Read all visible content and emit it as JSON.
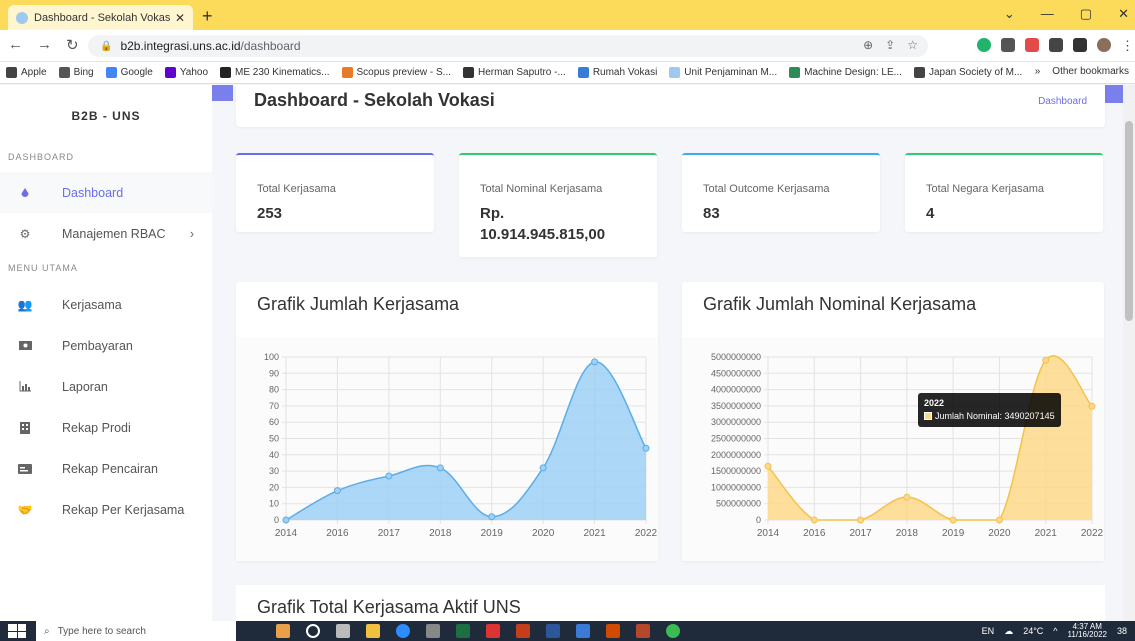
{
  "browser": {
    "tab_title": "Dashboard - Sekolah Vokasi — [",
    "url_host": "b2b.integrasi.uns.ac.id",
    "url_path": "/dashboard",
    "bookmarks": [
      "Apple",
      "Bing",
      "Google",
      "Yahoo",
      "ME 230 Kinematics...",
      "Scopus preview - S...",
      "Herman Saputro -...",
      "Rumah Vokasi",
      "Unit Penjaminan M...",
      "Machine Design: LE...",
      "Japan Society of M..."
    ],
    "other_bookmarks": "Other bookmarks"
  },
  "sidebar": {
    "brand": "B2B - UNS",
    "section_dashboard": "DASHBOARD",
    "section_menu": "MENU UTAMA",
    "items": [
      {
        "label": "Dashboard",
        "icon": "droplet-icon"
      },
      {
        "label": "Manajemen RBAC",
        "icon": "gears-icon"
      },
      {
        "label": "Kerjasama",
        "icon": "users-icon"
      },
      {
        "label": "Pembayaran",
        "icon": "money-icon"
      },
      {
        "label": "Laporan",
        "icon": "chart-icon"
      },
      {
        "label": "Rekap Prodi",
        "icon": "building-icon"
      },
      {
        "label": "Rekap Pencairan",
        "icon": "card-icon"
      },
      {
        "label": "Rekap Per Kerjasama",
        "icon": "handshake-icon"
      }
    ]
  },
  "header": {
    "title": "Dashboard - Sekolah Vokasi",
    "breadcrumb": "Dashboard"
  },
  "stats": [
    {
      "label": "Total Kerjasama",
      "value": "253",
      "color": "#6a6ee8"
    },
    {
      "label": "Total Nominal Kerjasama",
      "value": "Rp. 10.914.945.815,00",
      "color": "#2ecc71"
    },
    {
      "label": "Total Outcome Kerjasama",
      "value": "83",
      "color": "#3fa9f5"
    },
    {
      "label": "Total Negara Kerjasama",
      "value": "4",
      "color": "#2ecc71"
    }
  ],
  "charts": {
    "left_title": "Grafik Jumlah Kerjasama",
    "right_title": "Grafik Jumlah Nominal Kerjasama",
    "bottom_title": "Grafik Total Kerjasama Aktif UNS",
    "tooltip_year": "2022",
    "tooltip_label": "Jumlah Nominal: 3490207145"
  },
  "chart_data": [
    {
      "type": "area",
      "title": "Grafik Jumlah Kerjasama",
      "x": [
        "2014",
        "2016",
        "2017",
        "2018",
        "2019",
        "2020",
        "2021",
        "2022"
      ],
      "values": [
        0,
        18,
        27,
        32,
        2,
        32,
        97,
        44
      ],
      "ylim": [
        0,
        100
      ],
      "yticks": [
        0,
        10,
        20,
        30,
        40,
        50,
        60,
        70,
        80,
        90,
        100
      ],
      "color": "#5aaee8",
      "fill": "#9fd0f5"
    },
    {
      "type": "area",
      "title": "Grafik Jumlah Nominal Kerjasama",
      "x": [
        "2014",
        "2016",
        "2017",
        "2018",
        "2019",
        "2020",
        "2021",
        "2022"
      ],
      "series": [
        {
          "name": "Jumlah Nominal",
          "values": [
            1650000000,
            0,
            0,
            700000000,
            0,
            0,
            4900000000,
            3490207145
          ]
        }
      ],
      "ylim": [
        0,
        5000000000
      ],
      "yticks": [
        0,
        500000000,
        1000000000,
        1500000000,
        2000000000,
        2500000000,
        3000000000,
        3500000000,
        4000000000,
        4500000000,
        5000000000
      ],
      "color": "#f5c14a",
      "fill": "#fdd88a"
    }
  ],
  "taskbar": {
    "search_placeholder": "Type here to search",
    "weather": "24°C",
    "lang": "EN",
    "time": "4:37 AM",
    "date": "11/16/2022",
    "notif": "38"
  }
}
